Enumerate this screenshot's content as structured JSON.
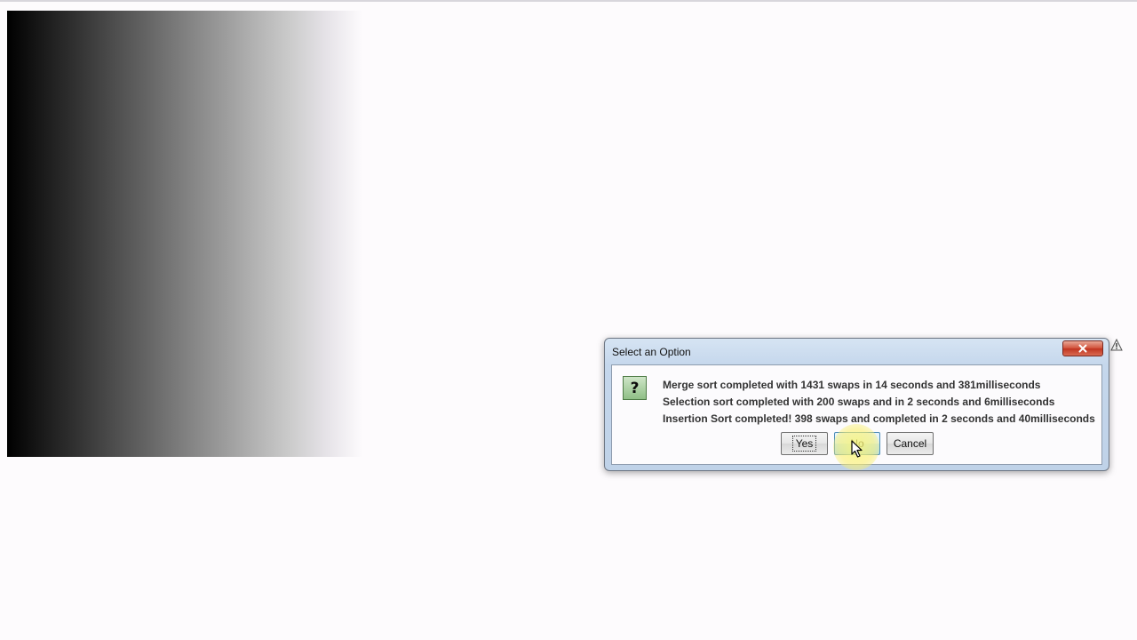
{
  "dialog": {
    "title": "Select an Option",
    "icon": "question-icon",
    "icon_glyph": "?",
    "messages": [
      "Merge sort completed with 1431 swaps in 14 seconds and 381milliseconds",
      "Selection sort completed with 200 swaps and in 2 seconds and 6milliseconds",
      "Insertion Sort completed! 398 swaps and completed in 2 seconds and 40milliseconds"
    ],
    "buttons": {
      "yes": "Yes",
      "no": "No",
      "cancel": "Cancel"
    }
  },
  "colors": {
    "gradient_start": "#000000",
    "gradient_end": "#fdfbfd",
    "close_button": "#c8432e",
    "dialog_frame": "#c5d7ec"
  }
}
